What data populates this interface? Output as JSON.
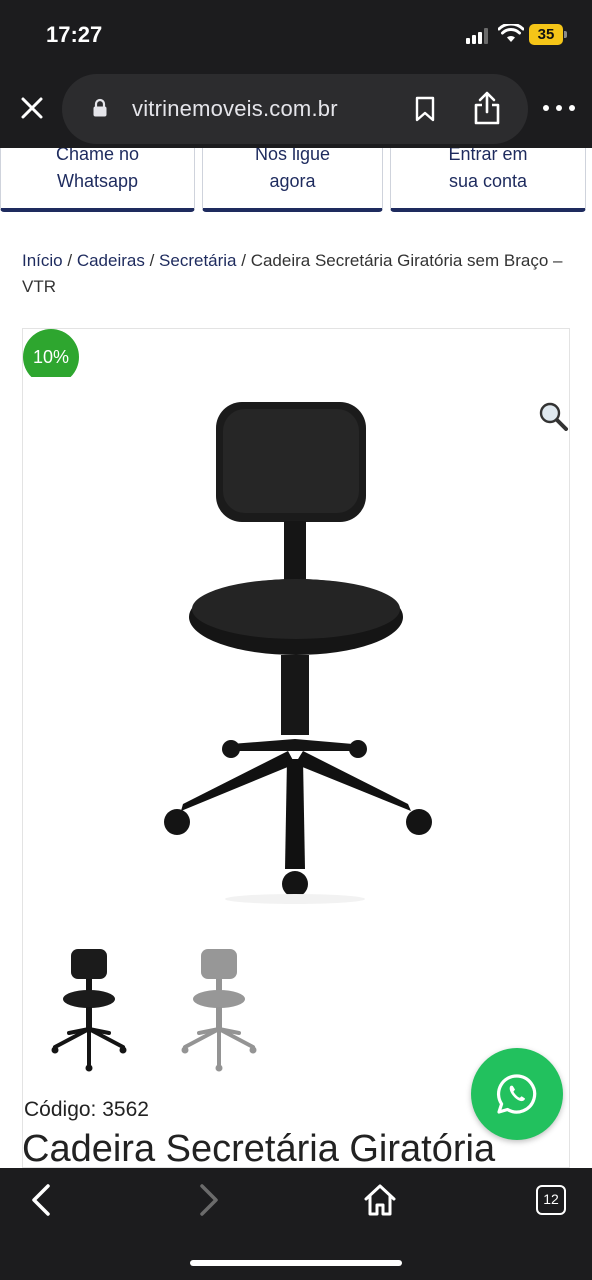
{
  "status_bar": {
    "time": "17:27",
    "battery": "35"
  },
  "browser": {
    "url": "vitrinemoveis.com.br",
    "tabs_count": "12"
  },
  "header_buttons": [
    {
      "line1": "Chame no",
      "line2": "Whatsapp"
    },
    {
      "line1": "Nos ligue",
      "line2": "agora"
    },
    {
      "line1": "Entrar em",
      "line2": "sua conta"
    }
  ],
  "breadcrumb": {
    "items": [
      "Início",
      "Cadeiras",
      "Secretária"
    ],
    "separator": " / ",
    "current": "Cadeira Secretária Giratória sem Braço – VTR"
  },
  "product": {
    "discount_badge": "10%",
    "code": "Código: 3562",
    "title": "Cadeira Secretária Giratória"
  },
  "colors": {
    "navy": "#1e2b5e",
    "badge_green": "#2ea62f",
    "whatsapp_green": "#22c15e",
    "chrome": "#1c1c1e"
  },
  "icons": [
    "close-icon",
    "lock-icon",
    "bookmark-icon",
    "share-icon",
    "more-icon",
    "search-zoom-icon",
    "whatsapp-icon",
    "back-icon",
    "forward-icon",
    "home-icon",
    "tabs-icon"
  ]
}
